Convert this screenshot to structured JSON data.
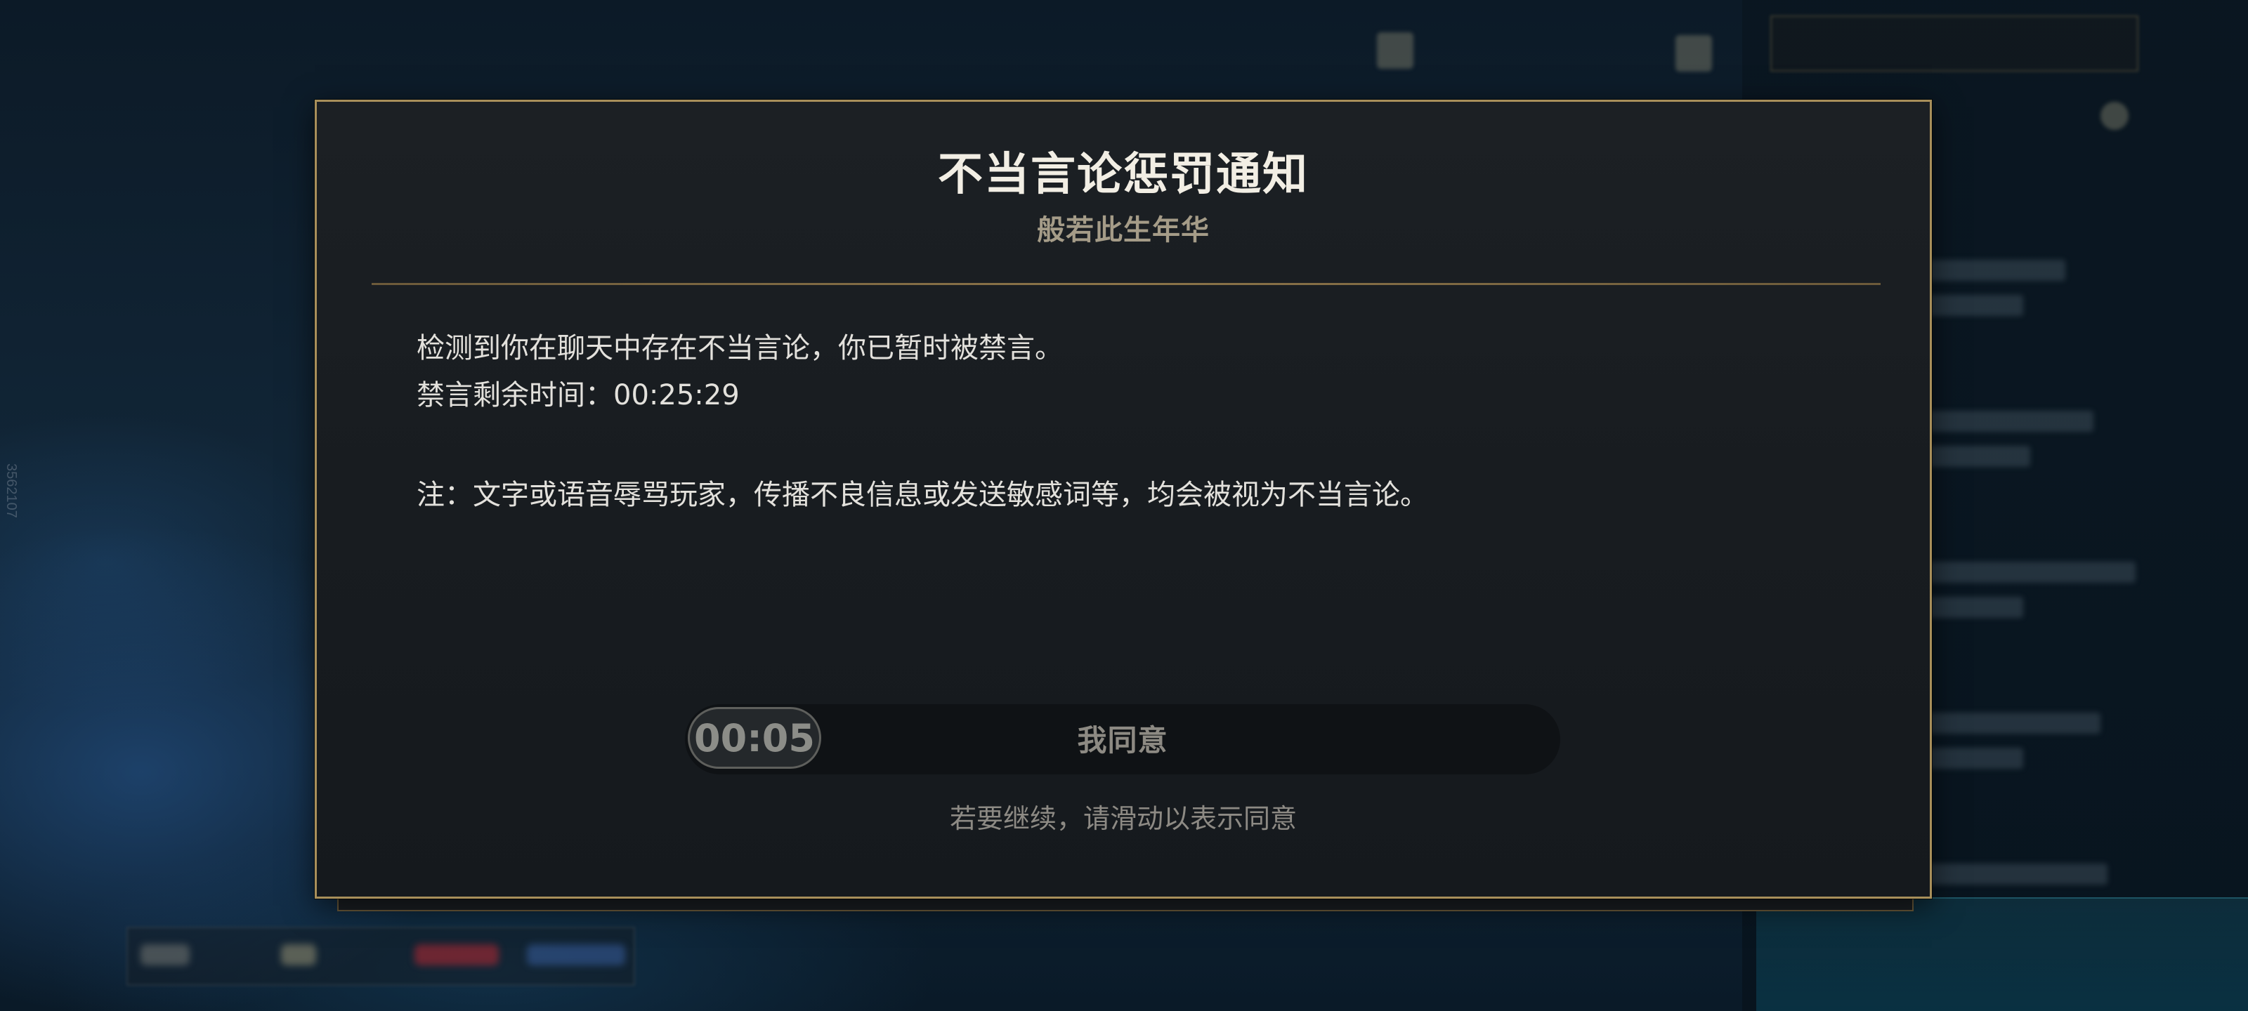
{
  "background": {
    "side_id": "3562107"
  },
  "dialog": {
    "title": "不当言论惩罚通知",
    "player_name": "般若此生年华",
    "message_line1": "检测到你在聊天中存在不当言论，你已暂时被禁言。",
    "mute_remaining_label": "禁言剩余时间：",
    "mute_remaining_time": "00:25:29",
    "note": "注：文字或语音辱骂玩家，传播不良信息或发送敏感词等，均会被视为不当言论。",
    "slider": {
      "countdown": "00:05",
      "label": "我同意",
      "progress": 0
    },
    "hint": "若要继续，请滑动以表示同意"
  },
  "colors": {
    "border_gold": "#a88f5a",
    "dialog_bg": "#1a1e22",
    "title_text": "#f2eee4",
    "subtitle_text": "#a59c88"
  }
}
